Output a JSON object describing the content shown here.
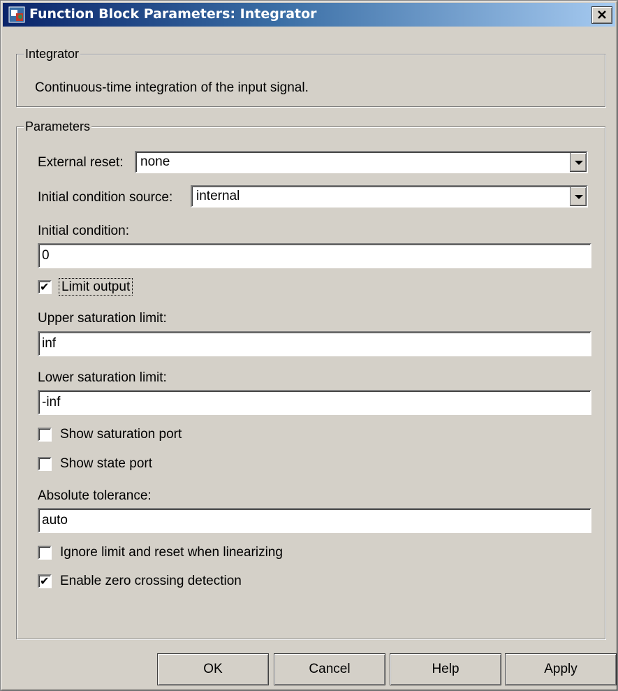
{
  "window": {
    "title": "Function Block Parameters: Integrator",
    "close_label": "×"
  },
  "block": {
    "group_title": "Integrator",
    "description": "Continuous-time integration of the input signal."
  },
  "params": {
    "group_title": "Parameters",
    "external_reset": {
      "label": "External reset:",
      "value": "none"
    },
    "ic_source": {
      "label": "Initial condition source:",
      "value": "internal"
    },
    "initial_condition": {
      "label": "Initial condition:",
      "value": "0"
    },
    "limit_output": {
      "label": "Limit output",
      "checked": true
    },
    "upper_limit": {
      "label": "Upper saturation limit:",
      "value": "inf"
    },
    "lower_limit": {
      "label": "Lower saturation limit:",
      "value": "-inf"
    },
    "show_saturation_port": {
      "label": "Show saturation port",
      "checked": false
    },
    "show_state_port": {
      "label": "Show state port",
      "checked": false
    },
    "abs_tolerance": {
      "label": "Absolute tolerance:",
      "value": "auto"
    },
    "ignore_limit": {
      "label": "Ignore limit and reset when linearizing",
      "checked": false
    },
    "zero_crossing": {
      "label": "Enable zero crossing detection",
      "checked": true
    }
  },
  "buttons": {
    "ok": "OK",
    "cancel": "Cancel",
    "help": "Help",
    "apply": "Apply"
  },
  "icons": {
    "window_icon": "simulink-block-icon",
    "check": "✔"
  },
  "colors": {
    "titlebar_start": "#0a246a",
    "titlebar_end": "#a6caf0",
    "dialog_bg": "#d4d0c8"
  }
}
